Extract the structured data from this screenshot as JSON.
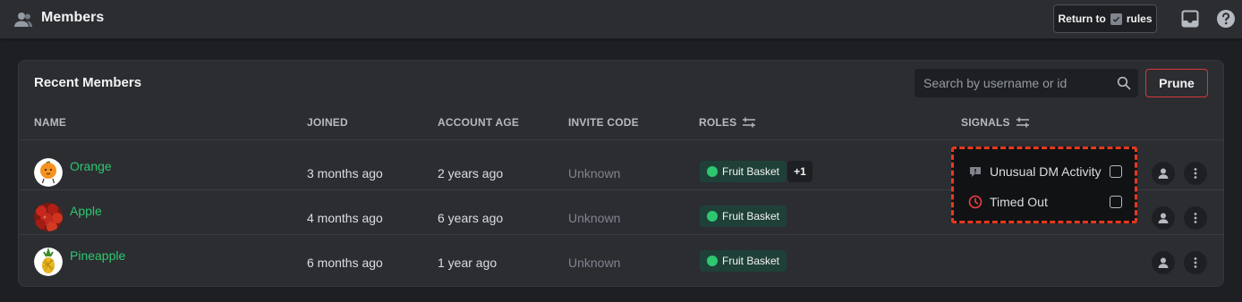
{
  "header": {
    "title": "Members",
    "return_prefix": "Return to",
    "return_suffix": "rules"
  },
  "panel": {
    "title": "Recent Members",
    "search_placeholder": "Search by username or id",
    "prune_label": "Prune",
    "columns": {
      "name": "NAME",
      "joined": "JOINED",
      "account_age": "ACCOUNT AGE",
      "invite_code": "INVITE CODE",
      "roles": "ROLES",
      "signals": "SIGNALS"
    }
  },
  "members": [
    {
      "name": "Orange",
      "joined": "3 months ago",
      "account_age": "2 years ago",
      "invite_code": "Unknown",
      "role": "Fruit Basket",
      "extra_roles": "+1"
    },
    {
      "name": "Apple",
      "joined": "4 months ago",
      "account_age": "6 years ago",
      "invite_code": "Unknown",
      "role": "Fruit Basket"
    },
    {
      "name": "Pineapple",
      "joined": "6 months ago",
      "account_age": "1 year ago",
      "invite_code": "Unknown",
      "role": "Fruit Basket"
    }
  ],
  "signals_menu": {
    "items": [
      {
        "label": "Unusual DM Activity",
        "icon": "message-alert-icon",
        "checked": false
      },
      {
        "label": "Timed Out",
        "icon": "clock-icon",
        "checked": false
      }
    ]
  },
  "colors": {
    "accent_green": "#2dc770",
    "danger_red": "#da373c",
    "highlight_dashes": "#e5391e"
  }
}
